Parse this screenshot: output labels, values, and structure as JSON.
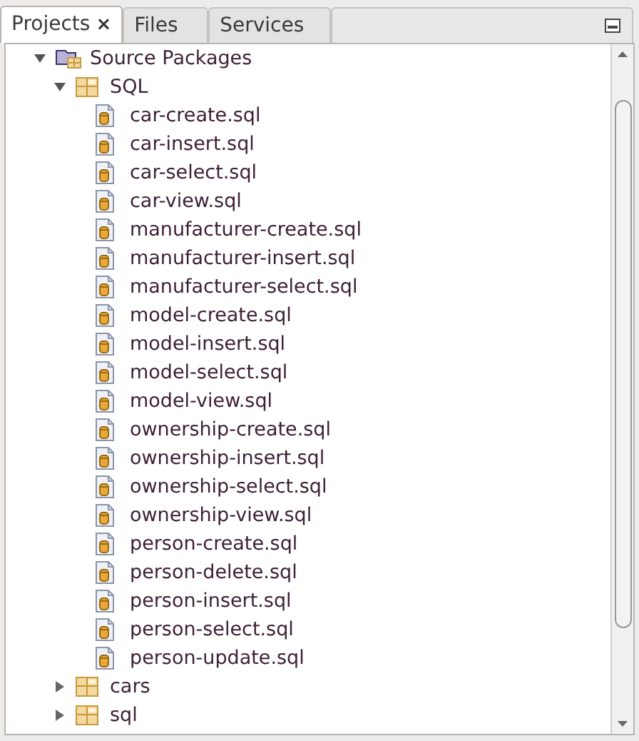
{
  "tabs": [
    {
      "label": "Projects",
      "selected": true,
      "close": "×"
    },
    {
      "label": "Files",
      "selected": false
    },
    {
      "label": "Services",
      "selected": false
    }
  ],
  "tree": [
    {
      "label": "Source Packages",
      "kind": "project",
      "expanded": true,
      "children": [
        {
          "label": "SQL",
          "kind": "package",
          "expanded": true,
          "children": [
            {
              "label": "car-create.sql",
              "kind": "file"
            },
            {
              "label": "car-insert.sql",
              "kind": "file"
            },
            {
              "label": "car-select.sql",
              "kind": "file"
            },
            {
              "label": "car-view.sql",
              "kind": "file"
            },
            {
              "label": "manufacturer-create.sql",
              "kind": "file"
            },
            {
              "label": "manufacturer-insert.sql",
              "kind": "file"
            },
            {
              "label": "manufacturer-select.sql",
              "kind": "file"
            },
            {
              "label": "model-create.sql",
              "kind": "file"
            },
            {
              "label": "model-insert.sql",
              "kind": "file"
            },
            {
              "label": "model-select.sql",
              "kind": "file"
            },
            {
              "label": "model-view.sql",
              "kind": "file"
            },
            {
              "label": "ownership-create.sql",
              "kind": "file"
            },
            {
              "label": "ownership-insert.sql",
              "kind": "file"
            },
            {
              "label": "ownership-select.sql",
              "kind": "file"
            },
            {
              "label": "ownership-view.sql",
              "kind": "file"
            },
            {
              "label": "person-create.sql",
              "kind": "file"
            },
            {
              "label": "person-delete.sql",
              "kind": "file"
            },
            {
              "label": "person-insert.sql",
              "kind": "file"
            },
            {
              "label": "person-select.sql",
              "kind": "file"
            },
            {
              "label": "person-update.sql",
              "kind": "file"
            }
          ]
        },
        {
          "label": "cars",
          "kind": "package",
          "expanded": false
        },
        {
          "label": "sql",
          "kind": "package",
          "expanded": false
        }
      ]
    }
  ]
}
